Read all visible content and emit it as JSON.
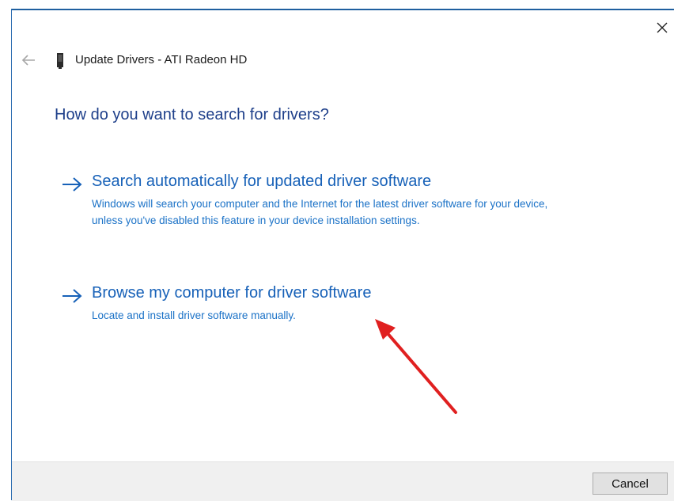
{
  "window": {
    "title": "Update Drivers - ATI Radeon HD"
  },
  "page": {
    "heading": "How do you want to search for drivers?"
  },
  "options": [
    {
      "title": "Search automatically for updated driver software",
      "description": "Windows will search your computer and the Internet for the latest driver software for your device, unless you've disabled this feature in your device installation settings."
    },
    {
      "title": "Browse my computer for driver software",
      "description": "Locate and install driver software manually."
    }
  ],
  "footer": {
    "cancel_label": "Cancel"
  },
  "icons": {
    "close": "close-icon",
    "back": "back-arrow-icon",
    "device": "device-icon",
    "option_arrow": "right-arrow-icon"
  },
  "colors": {
    "heading": "#1e3f8a",
    "link": "#1761b8",
    "annotation_arrow": "#e02020"
  }
}
